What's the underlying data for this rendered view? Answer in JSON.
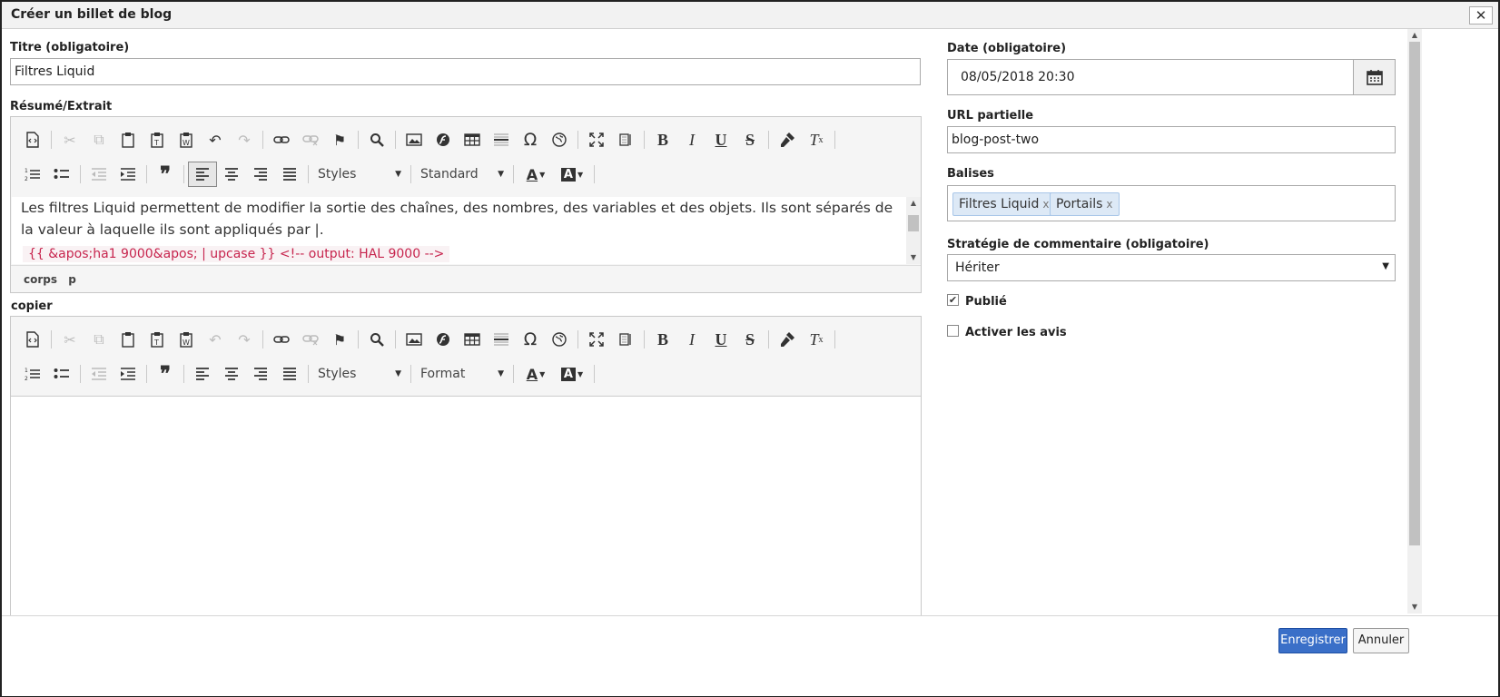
{
  "dialog": {
    "title": "Créer un billet de blog",
    "close": "✕"
  },
  "form": {
    "title_label": "Titre (obligatoire)",
    "title_value": "Filtres Liquid",
    "summary_label": "Résumé/Extrait",
    "copy_label": "copier",
    "date_label": "Date (obligatoire)",
    "date_value": "08/05/2018 20:30",
    "url_label": "URL partielle",
    "url_value": "blog-post-two",
    "tags_label": "Balises",
    "tags": [
      "Filtres Liquid",
      "Portails"
    ],
    "tag_remove": "x",
    "comment_label": "Stratégie de commentaire (obligatoire)",
    "comment_value": "Hériter",
    "comment_arrow": "▼",
    "published_label": "Publié",
    "published_checked": true,
    "reviews_label": "Activer les avis",
    "reviews_checked": false
  },
  "editor1": {
    "styles": "Styles",
    "format": "Standard",
    "paragraph": "Les filtres Liquid permettent de modifier la sortie des chaînes, des nombres, des variables et des objets. Ils sont séparés de la valeur à laquelle ils sont appliqués par |.",
    "code": "{{ &apos;ha1 9000&apos; | upcase }} <!-- output: HAL 9000 -->",
    "path": [
      "corps",
      "p"
    ]
  },
  "editor2": {
    "styles": "Styles",
    "format": "Format"
  },
  "footer": {
    "save": "Enregistrer",
    "cancel": "Annuler"
  },
  "colors": {
    "primary": "#3a6fc8",
    "code_text": "#c7254e",
    "tag_bg": "#dde9f6"
  }
}
